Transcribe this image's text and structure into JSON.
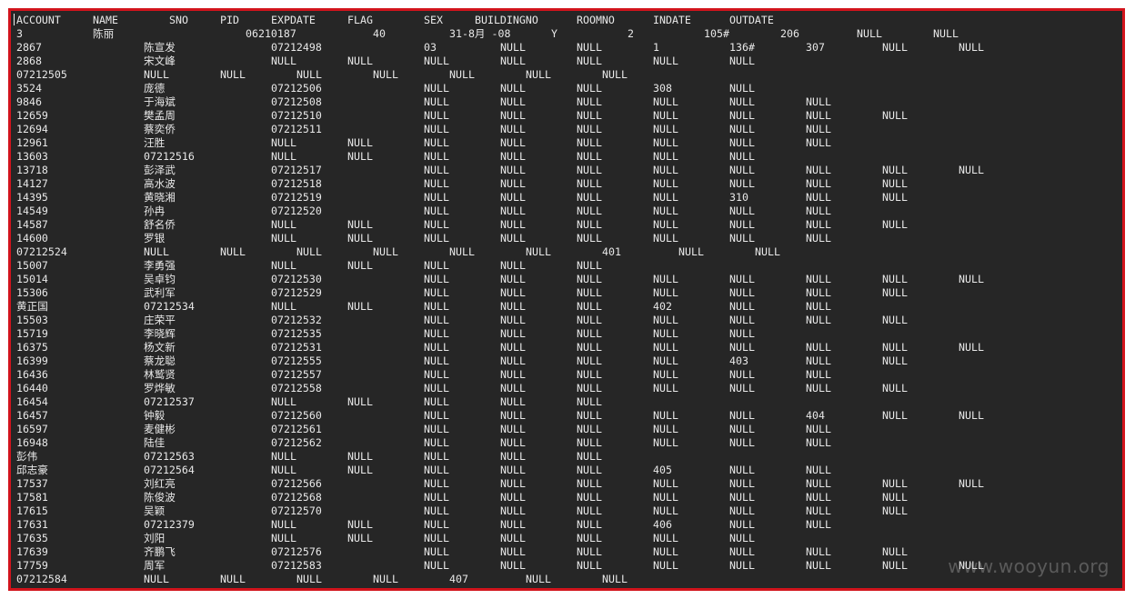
{
  "terminal": {
    "header": [
      "ACCOUNT",
      "NAME",
      "SNO",
      "PID",
      "EXPDATE",
      "FLAG",
      "SEX",
      "BUILDINGNO",
      "ROOMNO",
      "INDATE",
      "OUTDATE"
    ],
    "rows": [
      [
        "3",
        "陈丽",
        "",
        "",
        "",
        "06210187",
        "",
        "",
        "40",
        "31-8月 -08",
        "",
        "Y",
        "2",
        "105#",
        "206",
        "NULL",
        "NULL"
      ],
      [
        "2867",
        "",
        "",
        "陈宣发",
        "",
        "",
        "07212498",
        "",
        "",
        "",
        "03",
        "NULL",
        "NULL",
        "1",
        "136#",
        "307",
        "NULL",
        "NULL"
      ],
      [
        "2868",
        "",
        "",
        "宋文峰",
        "",
        "",
        "NULL",
        "NULL",
        "NULL",
        "NULL",
        "NULL",
        "NULL",
        "NULL"
      ],
      [
        "07212505",
        "",
        "",
        "NULL",
        "NULL",
        "NULL",
        "NULL",
        "NULL",
        "NULL",
        "NULL"
      ],
      [
        "3524",
        "",
        "",
        "庞德",
        "",
        "",
        "07212506",
        "",
        "",
        "",
        "NULL",
        "NULL",
        "NULL",
        "308",
        "NULL"
      ],
      [
        "9846",
        "",
        "",
        "于海斌",
        "",
        "",
        "07212508",
        "",
        "",
        "",
        "NULL",
        "NULL",
        "NULL",
        "NULL",
        "NULL",
        "NULL"
      ],
      [
        "12659",
        "",
        "",
        "樊孟周",
        "",
        "",
        "07212510",
        "",
        "",
        "",
        "NULL",
        "NULL",
        "NULL",
        "NULL",
        "NULL",
        "NULL",
        "NULL"
      ],
      [
        "12694",
        "",
        "",
        "蔡奕侨",
        "",
        "",
        "07212511",
        "",
        "",
        "",
        "NULL",
        "NULL",
        "NULL",
        "NULL",
        "NULL",
        "NULL"
      ],
      [
        "12961",
        "",
        "",
        "汪胜",
        "",
        "",
        "NULL",
        "NULL",
        "NULL",
        "NULL",
        "NULL",
        "NULL",
        "NULL",
        "NULL"
      ],
      [
        "13603",
        "",
        "",
        "07212516",
        "",
        "",
        "NULL",
        "NULL",
        "NULL",
        "NULL",
        "NULL",
        "NULL",
        "NULL"
      ],
      [
        "13718",
        "",
        "",
        "彭泽武",
        "",
        "",
        "07212517",
        "",
        "",
        "",
        "NULL",
        "NULL",
        "NULL",
        "NULL",
        "NULL",
        "NULL",
        "NULL",
        "NULL"
      ],
      [
        "14127",
        "",
        "",
        "高水波",
        "",
        "",
        "07212518",
        "",
        "",
        "",
        "NULL",
        "NULL",
        "NULL",
        "NULL",
        "NULL",
        "NULL",
        "NULL"
      ],
      [
        "14395",
        "",
        "",
        "黄晓湘",
        "",
        "",
        "07212519",
        "",
        "",
        "",
        "NULL",
        "NULL",
        "NULL",
        "NULL",
        "310",
        "NULL",
        "NULL"
      ],
      [
        "14549",
        "",
        "",
        "孙冉",
        "",
        "",
        "07212520",
        "",
        "",
        "",
        "NULL",
        "NULL",
        "NULL",
        "NULL",
        "NULL",
        "NULL"
      ],
      [
        "14587",
        "",
        "",
        "舒名侨",
        "",
        "",
        "NULL",
        "NULL",
        "NULL",
        "NULL",
        "NULL",
        "NULL",
        "NULL",
        "NULL",
        "NULL"
      ],
      [
        "14600",
        "",
        "",
        "罗银",
        "",
        "",
        "NULL",
        "NULL",
        "NULL",
        "NULL",
        "NULL",
        "NULL",
        "NULL",
        "NULL"
      ],
      [
        "07212524",
        "",
        "",
        "NULL",
        "NULL",
        "NULL",
        "NULL",
        "NULL",
        "NULL",
        "401",
        "NULL",
        "NULL"
      ],
      [
        "15007",
        "",
        "",
        "李勇强",
        "",
        "",
        "NULL",
        "NULL",
        "NULL",
        "NULL",
        "NULL"
      ],
      [
        "15014",
        "",
        "",
        "吴卓钧",
        "",
        "",
        "07212530",
        "",
        "",
        "",
        "NULL",
        "NULL",
        "NULL",
        "NULL",
        "NULL",
        "NULL",
        "NULL",
        "NULL"
      ],
      [
        "15306",
        "",
        "",
        "武利军",
        "",
        "",
        "07212529",
        "",
        "",
        "",
        "NULL",
        "NULL",
        "NULL",
        "NULL",
        "NULL",
        "NULL",
        "NULL"
      ],
      [
        "黄正国",
        "",
        "",
        "07212534",
        "",
        "",
        "NULL",
        "NULL",
        "NULL",
        "NULL",
        "NULL",
        "402",
        "NULL",
        "NULL"
      ],
      [
        "15503",
        "",
        "",
        "庄荣平",
        "",
        "",
        "07212532",
        "",
        "",
        "",
        "NULL",
        "NULL",
        "NULL",
        "NULL",
        "NULL",
        "NULL",
        "NULL"
      ],
      [
        "15719",
        "",
        "",
        "李晓辉",
        "",
        "",
        "07212535",
        "",
        "",
        "",
        "NULL",
        "NULL",
        "NULL",
        "NULL",
        "NULL"
      ],
      [
        "16375",
        "",
        "",
        "杨文新",
        "",
        "",
        "07212531",
        "",
        "",
        "",
        "NULL",
        "NULL",
        "NULL",
        "NULL",
        "NULL",
        "NULL",
        "NULL",
        "NULL"
      ],
      [
        "16399",
        "",
        "",
        "蔡龙聪",
        "",
        "",
        "07212555",
        "",
        "",
        "",
        "NULL",
        "NULL",
        "NULL",
        "NULL",
        "403",
        "NULL",
        "NULL"
      ],
      [
        "16436",
        "",
        "",
        "林鹫贤",
        "",
        "",
        "07212557",
        "",
        "",
        "",
        "NULL",
        "NULL",
        "NULL",
        "NULL",
        "NULL",
        "NULL"
      ],
      [
        "16440",
        "",
        "",
        "罗烨敏",
        "",
        "",
        "07212558",
        "",
        "",
        "",
        "NULL",
        "NULL",
        "NULL",
        "NULL",
        "NULL",
        "NULL",
        "NULL"
      ],
      [
        "16454",
        "",
        "",
        "07212537",
        "",
        "",
        "NULL",
        "NULL",
        "NULL",
        "NULL",
        "NULL"
      ],
      [
        "16457",
        "",
        "",
        "钟毅",
        "",
        "",
        "07212560",
        "",
        "",
        "",
        "NULL",
        "NULL",
        "NULL",
        "NULL",
        "NULL",
        "404",
        "NULL",
        "NULL"
      ],
      [
        "16597",
        "",
        "",
        "麦健彬",
        "",
        "",
        "07212561",
        "",
        "",
        "",
        "NULL",
        "NULL",
        "NULL",
        "NULL",
        "NULL",
        "NULL"
      ],
      [
        "16948",
        "",
        "",
        "陆佳",
        "",
        "",
        "07212562",
        "",
        "",
        "",
        "NULL",
        "NULL",
        "NULL",
        "NULL",
        "NULL",
        "NULL"
      ],
      [
        "彭伟",
        "",
        "",
        "07212563",
        "",
        "",
        "NULL",
        "NULL",
        "NULL",
        "NULL",
        "NULL"
      ],
      [
        "邱志豪",
        "",
        "",
        "07212564",
        "",
        "",
        "NULL",
        "NULL",
        "NULL",
        "NULL",
        "NULL",
        "405",
        "NULL",
        "NULL"
      ],
      [
        "17537",
        "",
        "",
        "刘红亮",
        "",
        "",
        "07212566",
        "",
        "",
        "",
        "NULL",
        "NULL",
        "NULL",
        "NULL",
        "NULL",
        "NULL",
        "NULL",
        "NULL"
      ],
      [
        "17581",
        "",
        "",
        "陈俊波",
        "",
        "",
        "07212568",
        "",
        "",
        "",
        "NULL",
        "NULL",
        "NULL",
        "NULL",
        "NULL",
        "NULL",
        "NULL"
      ],
      [
        "17615",
        "",
        "",
        "吴颖",
        "",
        "",
        "07212570",
        "",
        "",
        "",
        "NULL",
        "NULL",
        "NULL",
        "NULL",
        "NULL",
        "NULL",
        "NULL"
      ],
      [
        "17631",
        "",
        "",
        "07212379",
        "",
        "",
        "NULL",
        "NULL",
        "NULL",
        "NULL",
        "NULL",
        "406",
        "NULL",
        "NULL"
      ],
      [
        "17635",
        "",
        "",
        "刘阳",
        "",
        "",
        "NULL",
        "NULL",
        "NULL",
        "NULL",
        "NULL",
        "NULL",
        "NULL"
      ],
      [
        "17639",
        "",
        "",
        "齐鹏飞",
        "",
        "",
        "07212576",
        "",
        "",
        "",
        "NULL",
        "NULL",
        "NULL",
        "NULL",
        "NULL",
        "NULL",
        "NULL"
      ],
      [
        "17759",
        "",
        "",
        "周军",
        "",
        "",
        "07212583",
        "",
        "",
        "",
        "NULL",
        "NULL",
        "NULL",
        "NULL",
        "NULL",
        "NULL",
        "NULL",
        "NULL"
      ],
      [
        "07212584",
        "",
        "",
        "NULL",
        "NULL",
        "NULL",
        "NULL",
        "407",
        "NULL",
        "NULL"
      ]
    ]
  },
  "watermark": "www.wooyun.org",
  "colors": {
    "border": "#d2141c",
    "background": "#262626",
    "text": "#e8e8e8"
  }
}
